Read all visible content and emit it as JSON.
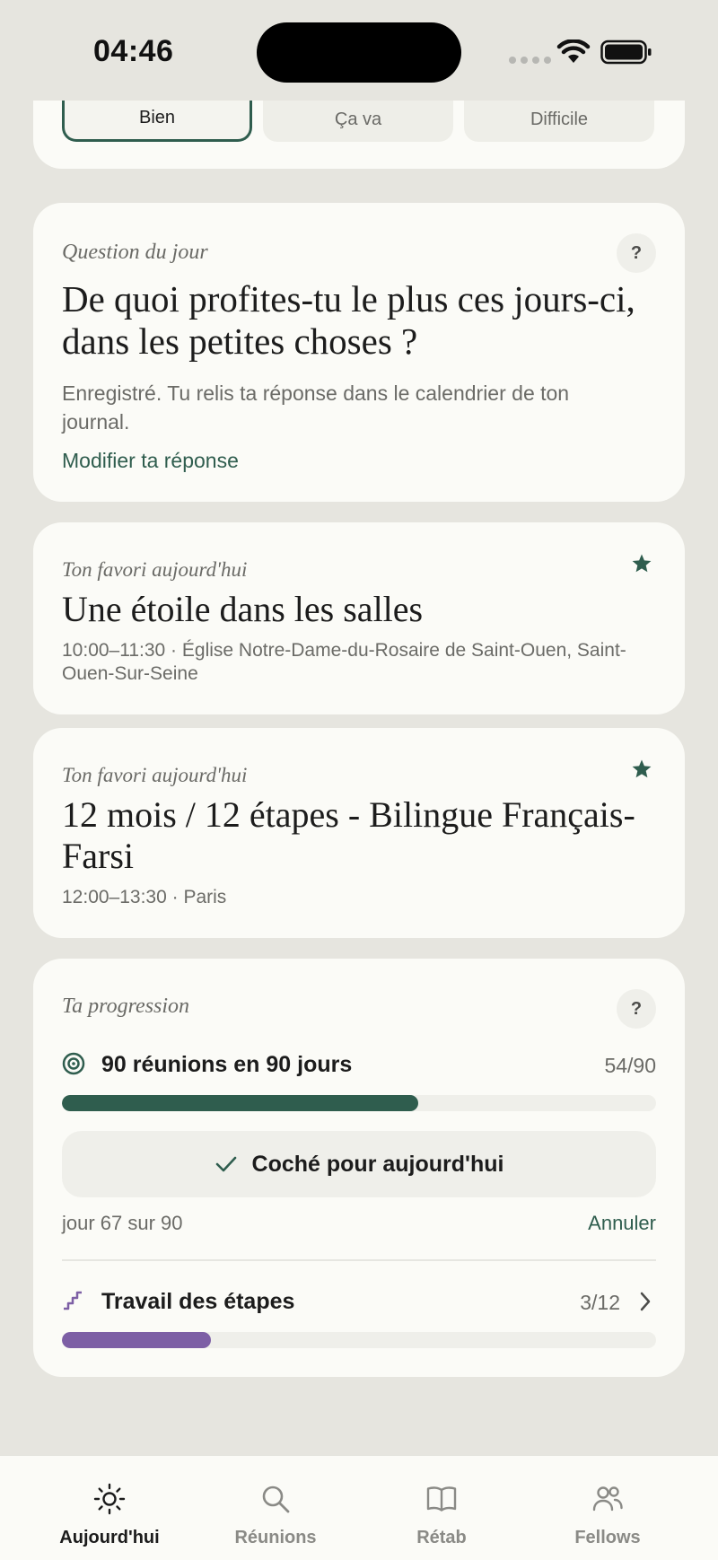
{
  "status_bar": {
    "time": "04:46"
  },
  "mood": {
    "options": [
      {
        "label": "Bien",
        "selected": true
      },
      {
        "label": "Ça va",
        "selected": false
      },
      {
        "label": "Difficile",
        "selected": false
      }
    ]
  },
  "question": {
    "eyebrow": "Question du jour",
    "help": "?",
    "text": "De quoi profites-tu le plus ces jours-ci, dans les petites choses ?",
    "note": "Enregistré. Tu relis ta réponse dans le calendrier de ton journal.",
    "edit_link": "Modifier ta réponse"
  },
  "favorites": [
    {
      "eyebrow": "Ton favori aujourd'hui",
      "title": "Une étoile dans les salles",
      "meta": "10:00–11:30 · Église Notre-Dame-du-Rosaire de Saint-Ouen, Saint-Ouen-Sur-Seine"
    },
    {
      "eyebrow": "Ton favori aujourd'hui",
      "title": "12 mois / 12 étapes - Bilingue Français-Farsi",
      "meta": "12:00–13:30 · Paris"
    }
  ],
  "progress": {
    "eyebrow": "Ta progression",
    "help": "?",
    "goal": {
      "label": "90 réunions en 90 jours",
      "count": "54/90",
      "fraction": 0.6
    },
    "check_button": "Coché pour aujourd'hui",
    "day_text": "jour 67 sur 90",
    "cancel": "Annuler",
    "steps": {
      "label": "Travail des étapes",
      "count": "3/12",
      "fraction": 0.25
    }
  },
  "colors": {
    "accent_green": "#2f5d4e",
    "steps_purple": "#7d5fa5",
    "background": "#e6e5df",
    "card": "#fbfbf7"
  },
  "tabs": [
    {
      "label": "Aujourd'hui",
      "icon": "sun-icon",
      "active": true
    },
    {
      "label": "Réunions",
      "icon": "search-icon",
      "active": false
    },
    {
      "label": "Rétab",
      "icon": "book-icon",
      "active": false
    },
    {
      "label": "Fellows",
      "icon": "people-icon",
      "active": false
    }
  ]
}
